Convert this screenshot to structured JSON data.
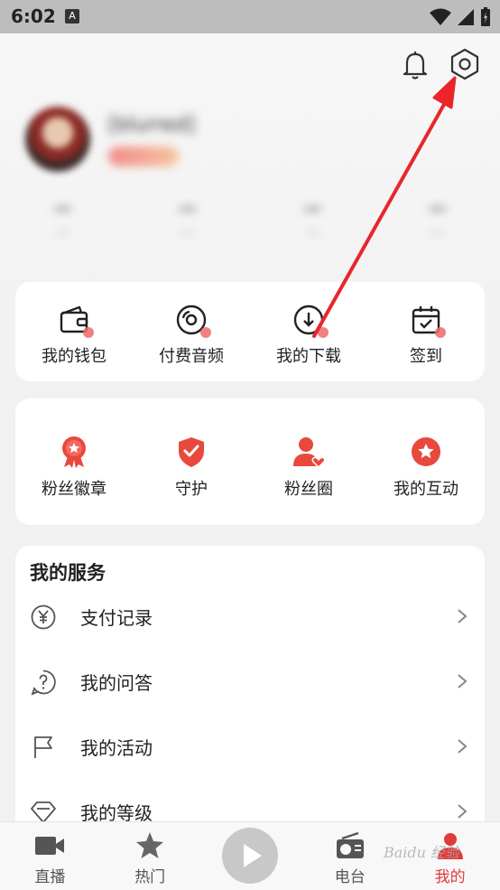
{
  "status_bar": {
    "time": "6:02",
    "app_icon": "A"
  },
  "header": {
    "bell_icon": "bell-icon",
    "settings_icon": "settings-icon"
  },
  "profile": {
    "name": "[blurred]",
    "stats": [
      "—",
      "—",
      "—",
      "—"
    ],
    "stat_labels": [
      "—",
      "—",
      "—",
      "—"
    ]
  },
  "quick_actions": [
    {
      "label": "我的钱包",
      "icon": "wallet-icon"
    },
    {
      "label": "付费音频",
      "icon": "disc-icon"
    },
    {
      "label": "我的下载",
      "icon": "download-icon"
    },
    {
      "label": "签到",
      "icon": "calendar-check-icon"
    }
  ],
  "fan_features": [
    {
      "label": "粉丝徽章",
      "icon": "badge-icon"
    },
    {
      "label": "守护",
      "icon": "shield-icon"
    },
    {
      "label": "粉丝圈",
      "icon": "fan-circle-icon"
    },
    {
      "label": "我的互动",
      "icon": "star-circle-icon"
    }
  ],
  "services": {
    "title": "我的服务",
    "items": [
      {
        "label": "支付记录",
        "icon": "yuan-icon"
      },
      {
        "label": "我的问答",
        "icon": "question-icon"
      },
      {
        "label": "我的活动",
        "icon": "flag-icon"
      },
      {
        "label": "我的等级",
        "icon": "diamond-icon"
      }
    ]
  },
  "bottom_nav": [
    {
      "label": "直播",
      "icon": "video-camera-icon"
    },
    {
      "label": "热门",
      "icon": "star-icon"
    },
    {
      "label": "",
      "icon": "play-icon"
    },
    {
      "label": "电台",
      "icon": "radio-icon"
    },
    {
      "label": "我的",
      "icon": "profile-icon"
    }
  ],
  "colors": {
    "accent": "#e23a3a",
    "icon_red": "#e8493d",
    "annotation_arrow": "#e8262c"
  },
  "watermark": "Baidu 经验"
}
